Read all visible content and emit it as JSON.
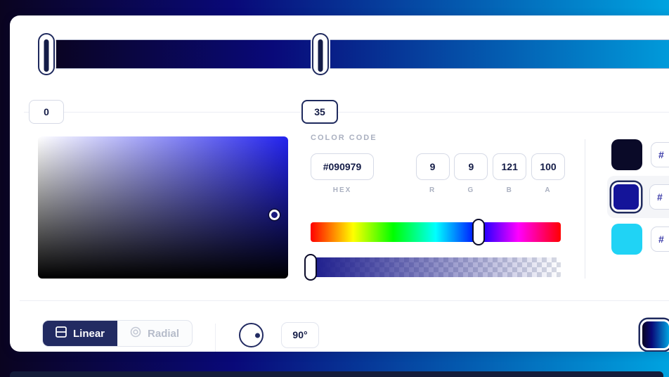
{
  "gradient": {
    "css": "linear-gradient(90deg, #0a0420 0%, #090979 35%, #00a3e0 100%)",
    "stops": [
      {
        "position_label": "0",
        "position": 0,
        "color": "#0a0420"
      },
      {
        "position_label": "35",
        "position": 35,
        "color": "#090979"
      }
    ]
  },
  "color_code": {
    "section_label": "COLOR CODE",
    "hex": {
      "value": "#090979",
      "caption": "HEX"
    },
    "r": {
      "value": "9",
      "caption": "R"
    },
    "g": {
      "value": "9",
      "caption": "G"
    },
    "b": {
      "value": "121",
      "caption": "B"
    },
    "a": {
      "value": "100",
      "caption": "A"
    }
  },
  "swatches": [
    {
      "color": "#0a0a28",
      "hex_text": "#"
    },
    {
      "color": "#141499",
      "hex_text": "#",
      "selected": true
    },
    {
      "color": "#20d3f5",
      "hex_text": "#"
    }
  ],
  "toolbar": {
    "linear_label": "Linear",
    "radial_label": "Radial",
    "active_type": "Linear",
    "angle_value": "90°"
  }
}
